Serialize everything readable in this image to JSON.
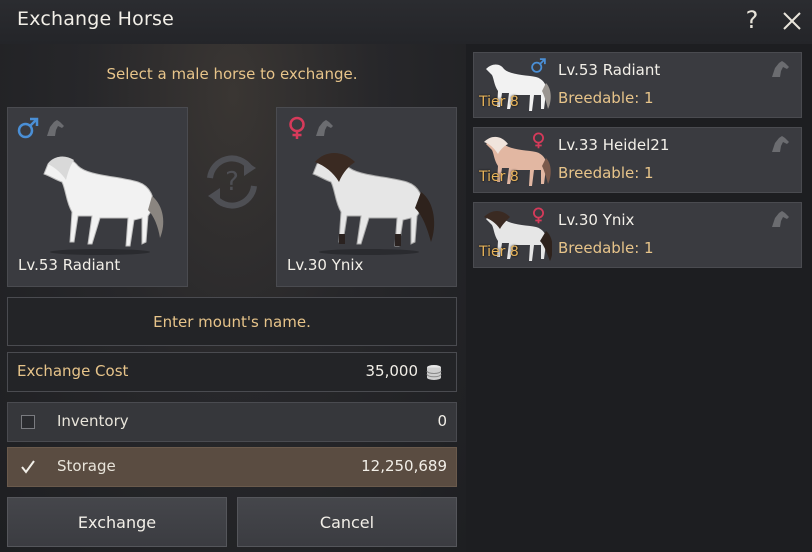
{
  "window": {
    "title": "Exchange Horse",
    "help_glyph": "?"
  },
  "instruction": "Select a male horse to exchange.",
  "slots": {
    "male": {
      "gender_icon": "male-symbol-icon",
      "name": "Lv.53 Radiant",
      "coat": "white"
    },
    "female": {
      "gender_icon": "female-symbol-icon",
      "name": "Lv.30 Ynix",
      "coat": "white-dark-mane"
    }
  },
  "swap_icon": "question-swap-icon",
  "name_field": {
    "placeholder": "Enter mount's name."
  },
  "cost": {
    "label": "Exchange Cost",
    "value": "35,000",
    "icon": "silver-coin-icon"
  },
  "inventory": {
    "label": "Inventory",
    "value": "0",
    "checked": false
  },
  "storage": {
    "label": "Storage",
    "value": "12,250,689",
    "checked": true
  },
  "buttons": {
    "exchange": "Exchange",
    "cancel": "Cancel"
  },
  "horse_list": [
    {
      "name": "Lv.53 Radiant",
      "breedable": "Breedable: 1",
      "tier": "Tier 8",
      "gender": "male"
    },
    {
      "name": "Lv.33 Heidel21",
      "breedable": "Breedable: 1",
      "tier": "Tier 8",
      "gender": "female"
    },
    {
      "name": "Lv.30 Ynix",
      "breedable": "Breedable: 1",
      "tier": "Tier 8",
      "gender": "female"
    }
  ],
  "colors": {
    "accent_text": "#e7c48a",
    "male_symbol": "#4a8fd6",
    "female_symbol": "#d63a5a",
    "tier_text": "#e7b35a",
    "storage_row": "#5a4c41"
  }
}
